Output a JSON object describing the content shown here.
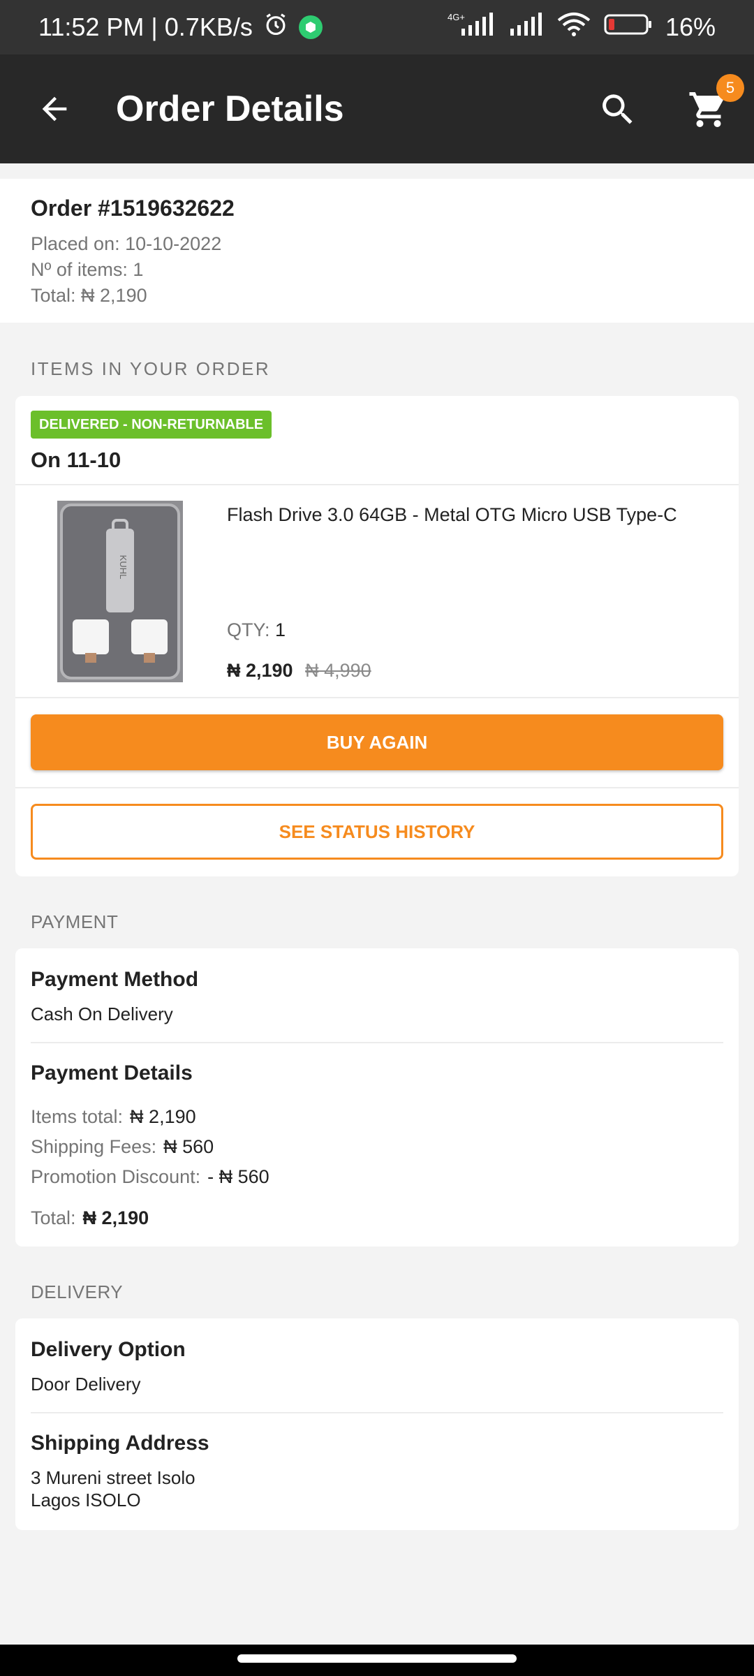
{
  "status_bar": {
    "time": "11:52 PM | 0.7KB/s",
    "network": "4G+",
    "battery": "16%",
    "icons": [
      "alarm-icon",
      "app-shield-icon",
      "signal-icon",
      "signal-icon",
      "wifi-icon",
      "battery-icon"
    ]
  },
  "app_bar": {
    "title": "Order Details",
    "cart_count": "5",
    "icons": [
      "back-arrow-icon",
      "search-icon",
      "cart-icon"
    ]
  },
  "order": {
    "number": "Order #1519632622",
    "placed_on": "Placed on: 10-10-2022",
    "items_count": "Nº of items: 1",
    "total": "Total: ₦ 2,190"
  },
  "items_section": {
    "label": "ITEMS IN YOUR ORDER",
    "status_chip": "DELIVERED - NON-RETURNABLE",
    "delivered_on": "On 11-10",
    "product": {
      "name": "Flash Drive 3.0 64GB - Metal OTG Micro USB Type-C",
      "qty_label": "QTY:",
      "qty_value": "1",
      "price": "₦ 2,190",
      "old_price": "₦ 4,990",
      "image_brand_text": "KUHL"
    },
    "buy_again_label": "BUY AGAIN",
    "status_history_label": "SEE STATUS HISTORY"
  },
  "payment": {
    "label": "PAYMENT",
    "method_title": "Payment Method",
    "method_value": "Cash On Delivery",
    "details_title": "Payment Details",
    "items_total_label": "Items total:",
    "items_total_value": "₦ 2,190",
    "shipping_label": "Shipping Fees:",
    "shipping_value": "₦ 560",
    "promo_label": "Promotion Discount:",
    "promo_value": "- ₦ 560",
    "total_label": "Total:",
    "total_value": "₦ 2,190"
  },
  "delivery": {
    "label": "DELIVERY",
    "option_title": "Delivery Option",
    "option_value": "Door Delivery",
    "address_title": "Shipping Address",
    "address_line1": "3 Mureni street Isolo",
    "address_line2": "Lagos ISOLO"
  },
  "colors": {
    "accent": "#f68b1e",
    "delivered_chip": "#6bbf2a",
    "app_bar": "#282828",
    "status_bar": "#333333",
    "page_bg": "#f3f3f3"
  }
}
